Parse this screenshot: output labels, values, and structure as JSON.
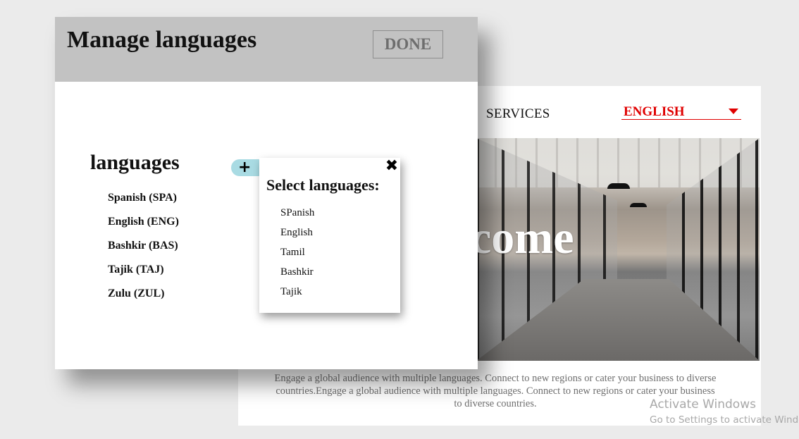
{
  "site": {
    "nav_services": "SERVICES",
    "language_select": {
      "selected": "ENGLISH",
      "accent_color": "#e00000"
    },
    "hero_text": "Welcome",
    "description": "Engage a global audience with multiple languages. Connect to new regions or cater your business to diverse countries.Engage a global audience with multiple languages. Connect to new regions or cater your business to diverse countries."
  },
  "modal": {
    "title": "Manage languages",
    "done_label": "DONE",
    "languages_heading": "languages",
    "add_icon": "plus-icon",
    "languages": [
      {
        "label": "Spanish (SPA)"
      },
      {
        "label": "English (ENG)"
      },
      {
        "label": "Bashkir (BAS)"
      },
      {
        "label": "Tajik (TAJ)"
      },
      {
        "label": "Zulu (ZUL)"
      }
    ]
  },
  "popup": {
    "title": "Select languages:",
    "close_icon": "close-icon",
    "options": [
      {
        "label": "SPanish"
      },
      {
        "label": "English"
      },
      {
        "label": "Tamil"
      },
      {
        "label": "Bashkir"
      },
      {
        "label": "Tajik"
      }
    ]
  },
  "watermark": {
    "title": "Activate Windows",
    "subtitle": "Go to Settings to activate Windows."
  }
}
